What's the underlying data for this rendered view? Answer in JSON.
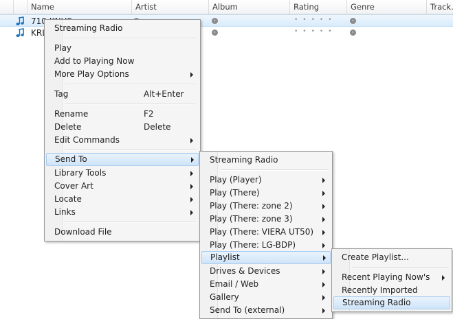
{
  "columns": [
    "",
    "",
    "Name",
    "Artist",
    "Album",
    "Rating",
    "Genre",
    "Track."
  ],
  "rows": [
    {
      "name": "710 KNUS",
      "selected": true,
      "icon": "music-note-icon"
    },
    {
      "name": "KRL",
      "selected": false,
      "icon": "music-note-icon"
    }
  ],
  "menu1": {
    "items": [
      {
        "label": "Streaming Radio"
      },
      {
        "label": "Play"
      },
      {
        "label": "Add to Playing Now"
      },
      {
        "label": "More Play Options",
        "submenu": true
      },
      {
        "label": "Tag",
        "shortcut": "Alt+Enter"
      },
      {
        "label": "Rename",
        "shortcut": "F2"
      },
      {
        "label": "Delete",
        "shortcut": "Delete"
      },
      {
        "label": "Edit Commands",
        "submenu": true
      },
      {
        "label": "Send To",
        "submenu": true,
        "highlighted": true
      },
      {
        "label": "Library Tools",
        "submenu": true
      },
      {
        "label": "Cover Art",
        "submenu": true
      },
      {
        "label": "Locate",
        "submenu": true
      },
      {
        "label": "Links",
        "submenu": true
      },
      {
        "label": "Download File"
      }
    ]
  },
  "menu2": {
    "items": [
      {
        "label": "Streaming Radio"
      },
      {
        "label": "Play (Player)",
        "submenu": true
      },
      {
        "label": "Play (There)",
        "submenu": true
      },
      {
        "label": "Play (There: zone 2)",
        "submenu": true
      },
      {
        "label": "Play (There: zone 3)",
        "submenu": true
      },
      {
        "label": "Play (There: VIERA UT50)",
        "submenu": true
      },
      {
        "label": "Play (There: LG-BDP)",
        "submenu": true
      },
      {
        "label": "Playlist",
        "submenu": true,
        "highlighted": true
      },
      {
        "label": "Drives & Devices",
        "submenu": true
      },
      {
        "label": "Email / Web",
        "submenu": true
      },
      {
        "label": "Gallery",
        "submenu": true
      },
      {
        "label": "Send To (external)",
        "submenu": true
      }
    ]
  },
  "menu3": {
    "items": [
      {
        "label": "Create Playlist..."
      },
      {
        "label": "Recent Playing Now's",
        "submenu": true
      },
      {
        "label": "Recently Imported"
      },
      {
        "label": "Streaming Radio",
        "highlighted": true
      }
    ]
  },
  "colors": {
    "accent": "#cfe4f8",
    "icon_blue": "#1e73be"
  }
}
